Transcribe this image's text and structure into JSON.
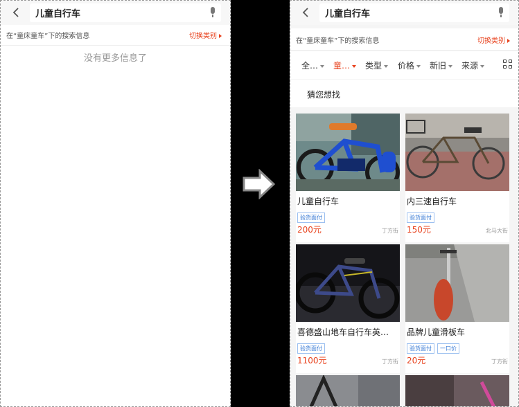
{
  "left_screen": {
    "search_text": "儿童自行车",
    "hint_text": "在“童床童车”下的搜索信息",
    "switch_label": "切换类别",
    "empty_message": "没有更多信息了"
  },
  "right_screen": {
    "search_text": "儿童自行车",
    "hint_text": "在“童床童车”下的搜索信息",
    "switch_label": "切换类别",
    "filters": [
      "全…",
      "童…",
      "类型",
      "价格",
      "新旧",
      "来源"
    ],
    "guess_label": "猜您想找",
    "products": [
      {
        "title": "儿童自行车",
        "tags": [
          "验货面付"
        ],
        "price": "200元",
        "location": "丁方街"
      },
      {
        "title": "内三速自行车",
        "tags": [
          "验货面付"
        ],
        "price": "150元",
        "location": "北马大街"
      },
      {
        "title": "喜德盛山地车自行车英…",
        "tags": [
          "验货面付"
        ],
        "price": "1100元",
        "location": "丁方街"
      },
      {
        "title": "品牌儿童滑板车",
        "tags": [
          "验货面付",
          "一口价"
        ],
        "price": "20元",
        "location": "丁方街"
      }
    ]
  },
  "colors": {
    "accent": "#e8421d",
    "tag_blue": "#3a7bd5"
  },
  "icons": [
    "back-arrow-icon",
    "microphone-icon",
    "triangle-right-icon",
    "dropdown-icon",
    "grid-view-icon",
    "transition-arrow-icon"
  ]
}
